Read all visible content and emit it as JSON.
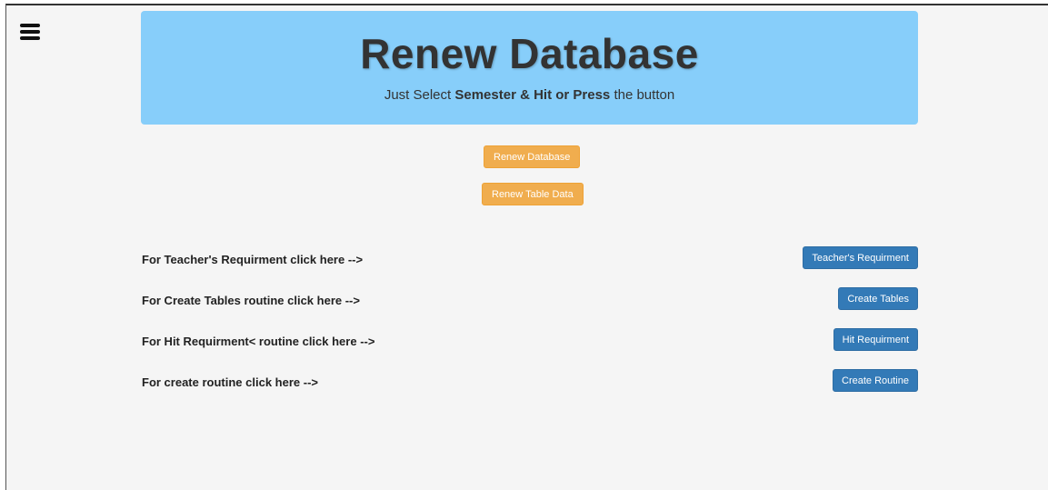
{
  "header": {
    "title": "Renew Database",
    "subtitle_pre": "Just Select ",
    "subtitle_bold1": "Semester",
    "subtitle_mid": " & ",
    "subtitle_bold2": "Hit or Press",
    "subtitle_post": " the button"
  },
  "icons": {
    "menu": "hamburger-icon"
  },
  "actions": {
    "renew_database": "Renew Database",
    "renew_table_data": "Renew Table Data"
  },
  "rows": [
    {
      "label": "For Teacher's Requirment click here -->",
      "button": "Teacher's Requirment"
    },
    {
      "label": "For Create Tables routine click here -->",
      "button": "Create Tables"
    },
    {
      "label": "For Hit Requirment< routine click here -->",
      "button": "Hit Requirment"
    },
    {
      "label": "For create routine click here -->",
      "button": "Create Routine"
    }
  ],
  "colors": {
    "jumbotron": "#87cefa",
    "warning_button": "#f0ad4e",
    "primary_button": "#337ab7",
    "background": "#f5f5f5"
  }
}
